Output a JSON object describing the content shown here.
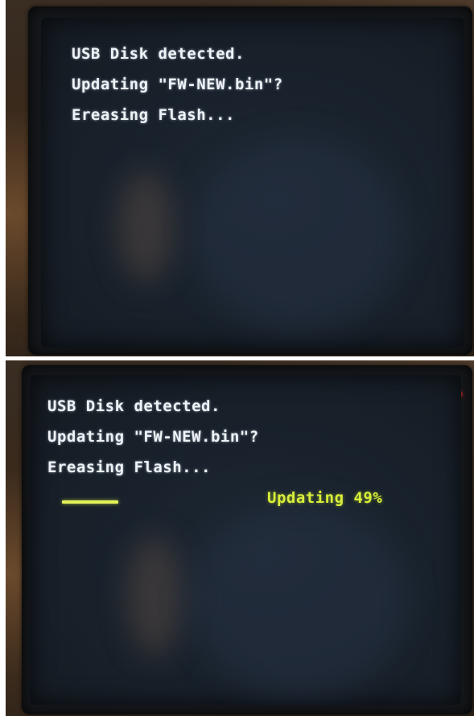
{
  "top_photo": {
    "lines": [
      "USB Disk detected.",
      "Updating \"FW-NEW.bin\"?",
      "Ereasing Flash..."
    ]
  },
  "bottom_photo": {
    "lines": [
      "USB Disk detected.",
      "Updating \"FW-NEW.bin\"?",
      "Ereasing Flash..."
    ],
    "progress_label": "Updating 49%",
    "progress_fraction": 0.14
  },
  "colors": {
    "console_text": "#eef3f6",
    "progress_text": "#d8ee3a",
    "screen_background": "#19222c"
  }
}
